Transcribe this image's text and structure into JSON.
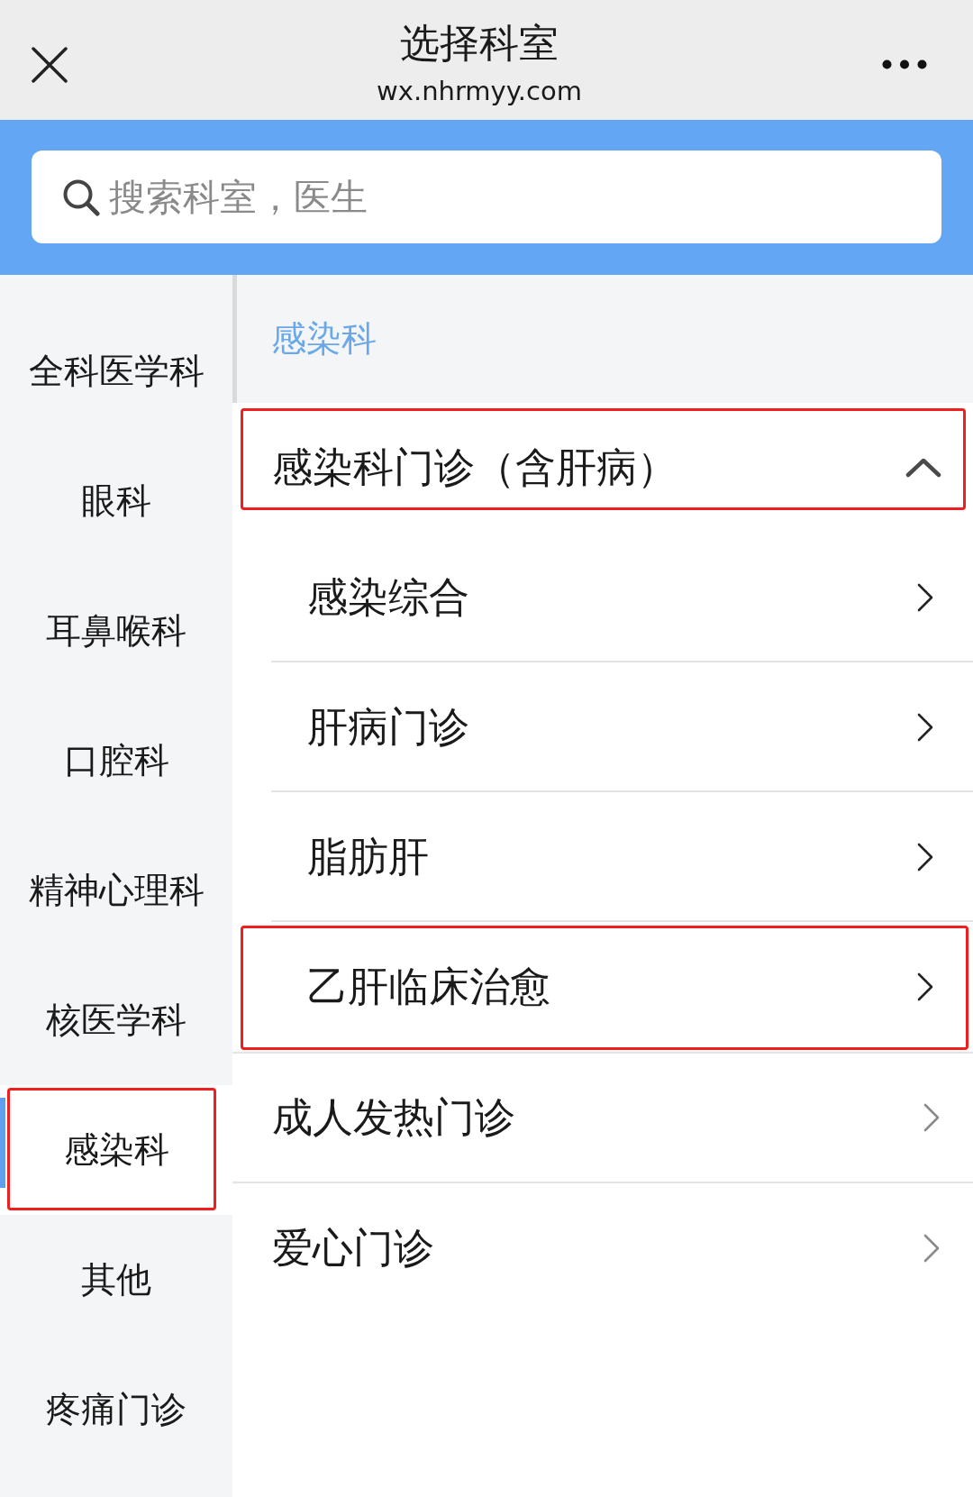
{
  "header": {
    "title": "选择科室",
    "url": "wx.nhrmyy.com"
  },
  "search": {
    "placeholder": "搜索科室，医生"
  },
  "sidebar": {
    "items": [
      {
        "label": "全科医学科",
        "selected": false,
        "highlighted": false
      },
      {
        "label": "眼科",
        "selected": false,
        "highlighted": false
      },
      {
        "label": "耳鼻喉科",
        "selected": false,
        "highlighted": false
      },
      {
        "label": "口腔科",
        "selected": false,
        "highlighted": false
      },
      {
        "label": "精神心理科",
        "selected": false,
        "highlighted": false
      },
      {
        "label": "核医学科",
        "selected": false,
        "highlighted": false
      },
      {
        "label": "感染科",
        "selected": true,
        "highlighted": true
      },
      {
        "label": "其他",
        "selected": false,
        "highlighted": false
      },
      {
        "label": "疼痛门诊",
        "selected": false,
        "highlighted": false
      }
    ]
  },
  "department": {
    "title": "感染科",
    "items": [
      {
        "kind": "group",
        "label": "感染科门诊（含肝病）",
        "expanded": true,
        "highlighted": true,
        "children": [
          {
            "label": "感染综合",
            "highlighted": false
          },
          {
            "label": "肝病门诊",
            "highlighted": false
          },
          {
            "label": "脂肪肝",
            "highlighted": false
          },
          {
            "label": "乙肝临床治愈",
            "highlighted": true
          }
        ]
      },
      {
        "kind": "link",
        "label": "成人发热门诊",
        "highlighted": false
      },
      {
        "kind": "link",
        "label": "爱心门诊",
        "highlighted": false
      }
    ]
  }
}
